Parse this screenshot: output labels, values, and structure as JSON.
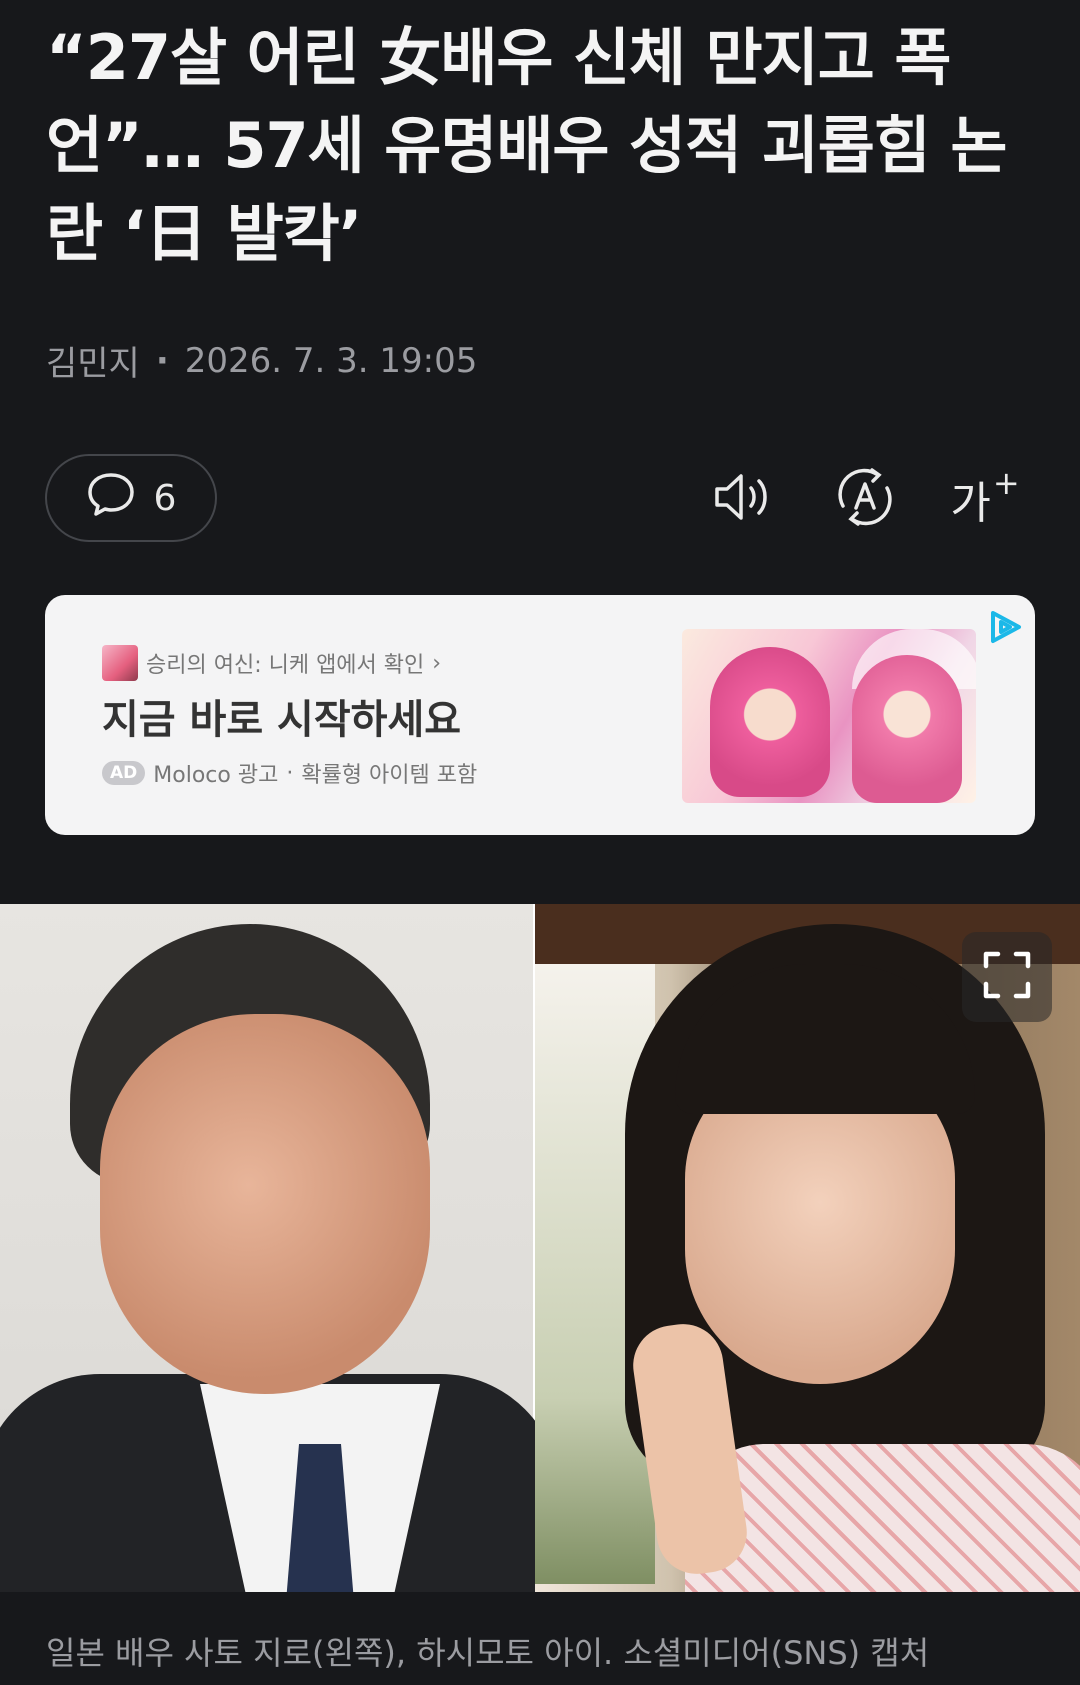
{
  "article": {
    "headline": "“27살 어린 女배우 신체 만지고 폭언”… 57세 유명배우 성적 괴롭힘 논란 ‘日 발칵’",
    "author": "김민지",
    "separator": "·",
    "datetime": "2026. 7. 3. 19:05"
  },
  "toolbar": {
    "comment_count": "6",
    "font_label": "가",
    "font_plus": "+",
    "icons": [
      "comment-icon",
      "speaker-icon",
      "translate-icon",
      "font-size-icon"
    ]
  },
  "ad": {
    "source": "승리의 여신: 니케 앱에서 확인",
    "source_chevron": "›",
    "title": "지금 바로 시작하세요",
    "badge": "AD",
    "advertiser": "Moloco 광고",
    "note_separator": "·",
    "note": "확률형 아이템 포함",
    "accent_color": "#1bb8e8"
  },
  "photo": {
    "caption": "일본 배우 사토 지로(왼쪽), 하시모토 아이. 소셜미디어(SNS) 캡처"
  }
}
